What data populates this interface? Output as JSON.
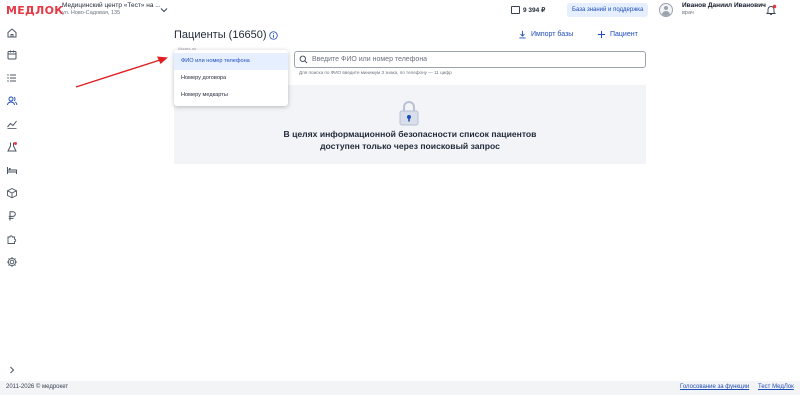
{
  "header": {
    "logo": "МЕДЛОК",
    "clinic_name": "Медицинский центр «Тест» на ...",
    "clinic_address": "ул. Ново-Садовая, 135",
    "balance": "9 394 ₽",
    "knowledge_base_label": "База знаний и поддержка",
    "user_name": "Иванов Даниил Иванович",
    "user_role": "врач"
  },
  "sidebar": {
    "items": [
      {
        "icon": "home-icon"
      },
      {
        "icon": "calendar-icon"
      },
      {
        "icon": "list-icon"
      },
      {
        "icon": "patients-icon",
        "active": true
      },
      {
        "icon": "analytics-icon"
      },
      {
        "icon": "lab-icon"
      },
      {
        "icon": "bed-icon"
      },
      {
        "icon": "box-icon"
      },
      {
        "icon": "ruble-icon"
      },
      {
        "icon": "puzzle-icon"
      },
      {
        "icon": "settings-icon"
      },
      {
        "icon": "expand-icon"
      }
    ]
  },
  "page": {
    "title": "Пациенты (16650)",
    "import_label": "Импорт базы",
    "add_label": "Пациент"
  },
  "search": {
    "select_caption": "Искать по",
    "placeholder": "Введите ФИО или номер телефона",
    "hint": "Для поиска по ФИО введите минимум 3 знака, по телефону — 11 цифр",
    "options": [
      "ФИО или номер телефона",
      "Номеру договора",
      "Номеру медкарты"
    ],
    "selected": "ФИО или номер телефона"
  },
  "notice": {
    "line1": "В целях информационной безопасности список пациентов",
    "line2": "доступен только через поисковый запрос"
  },
  "footer": {
    "copyright": "2011-2026 © медрокет",
    "link1": "Голосование за функции",
    "link2": "Тест МедЛок"
  },
  "colors": {
    "accent": "#1f4db8",
    "brand": "#e63946",
    "notice_bg": "#f2f4f8",
    "annotation_arrow": "#e02020"
  }
}
